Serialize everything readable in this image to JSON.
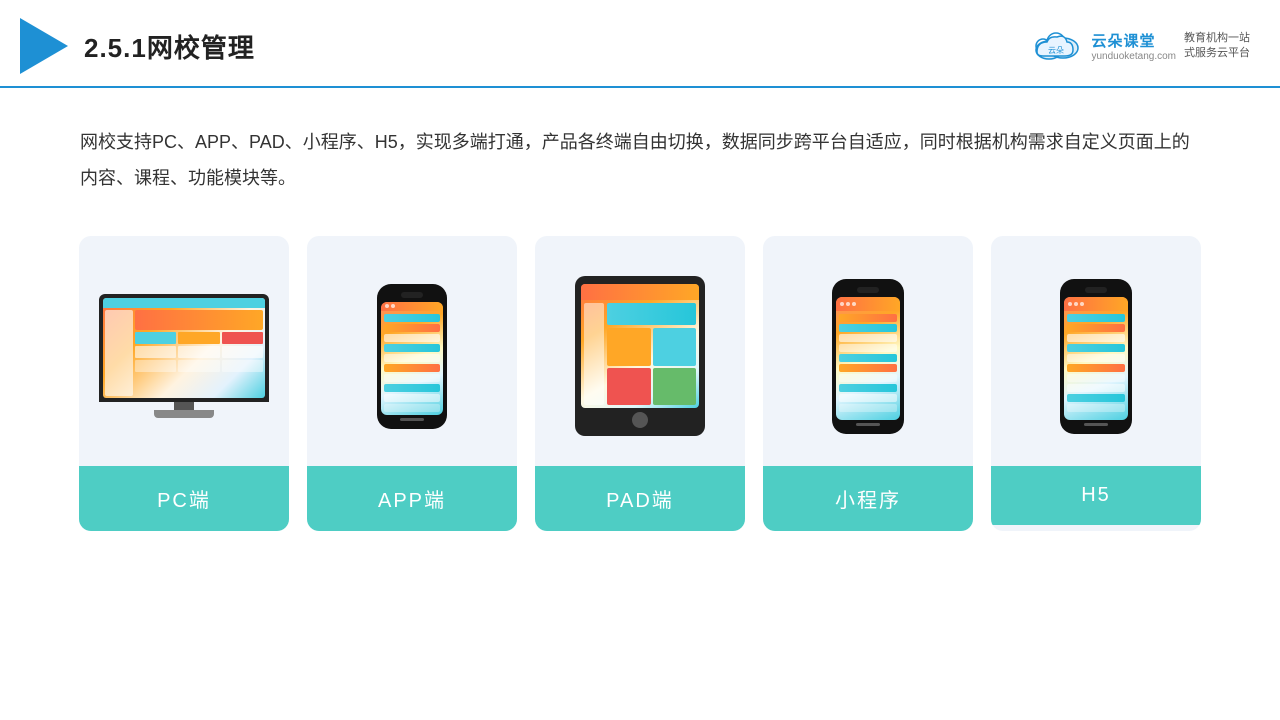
{
  "header": {
    "title": "2.5.1网校管理",
    "brand_name": "云朵课堂",
    "brand_domain": "yunduoketang.com",
    "brand_slogan": "教育机构一站\n式服务云平台"
  },
  "description": {
    "text": "网校支持PC、APP、PAD、小程序、H5，实现多端打通，产品各终端自由切换，数据同步跨平台自适应，同时根据机构需求自定义页面上的内容、课程、功能模块等。"
  },
  "cards": [
    {
      "id": "pc",
      "label": "PC端",
      "type": "pc"
    },
    {
      "id": "app",
      "label": "APP端",
      "type": "phone"
    },
    {
      "id": "pad",
      "label": "PAD端",
      "type": "tablet"
    },
    {
      "id": "miniprogram",
      "label": "小程序",
      "type": "phone"
    },
    {
      "id": "h5",
      "label": "H5",
      "type": "phone"
    }
  ],
  "colors": {
    "accent": "#1e90d4",
    "card_bg": "#eef2f8",
    "label_bg": "#4eccd4",
    "header_border": "#1e90d4"
  }
}
